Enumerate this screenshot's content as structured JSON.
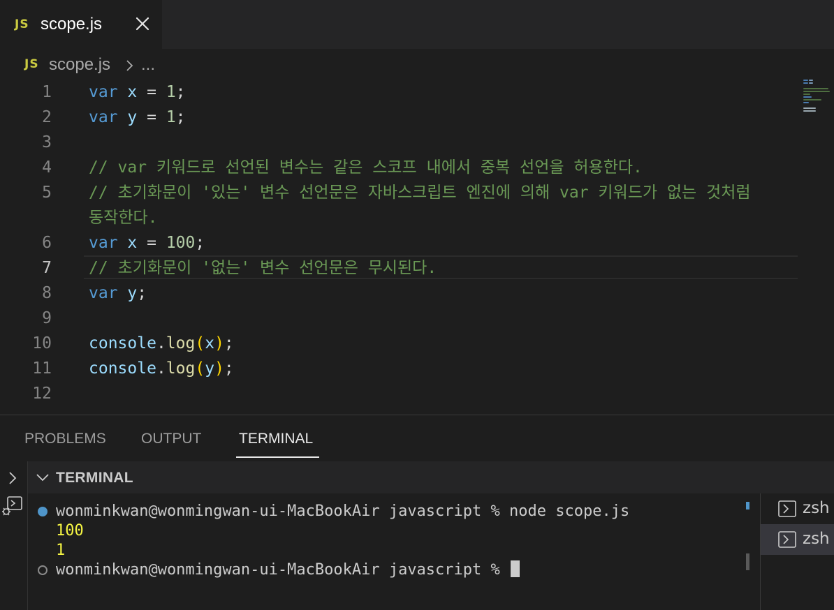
{
  "tab": {
    "badge": "JS",
    "title": "scope.js"
  },
  "breadcrumb": {
    "badge": "JS",
    "file": "scope.js",
    "more": "..."
  },
  "editor": {
    "line_numbers": [
      "1",
      "2",
      "3",
      "4",
      "5",
      "6",
      "7",
      "8",
      "9",
      "10",
      "11",
      "12"
    ],
    "current_line": "7",
    "code": {
      "kw_var": "var",
      "x": "x",
      "y": "y",
      "eq": " = ",
      "one": "1",
      "hundred": "100",
      "semi": ";",
      "comment_line4": "// var 키워드로 선언된 변수는 같은 스코프 내에서 중복 선언을 허용한다.",
      "comment_line5": "// 초기화문이 '있는' 변수 선언문은 자바스크립트 엔진에 의해 var 키워드가 없는 것처럼",
      "comment_line5_wrap": "동작한다.",
      "comment_line7": "// 초기화문이 '없는' 변수 선언문은 무시된다.",
      "console": "console",
      "dot": ".",
      "log": "log",
      "open_paren": "(",
      "close_paren": ")"
    }
  },
  "panel": {
    "tabs": [
      "PROBLEMS",
      "OUTPUT",
      "TERMINAL"
    ],
    "active_tab": "TERMINAL",
    "header_title": "TERMINAL"
  },
  "terminal": {
    "lines": [
      "wonminkwan@wonmingwan-ui-MacBookAir javascript % node scope.js",
      "100",
      "1",
      "wonminkwan@wonmingwan-ui-MacBookAir javascript % "
    ],
    "instances": [
      "zsh",
      "zsh"
    ],
    "selected_instance": 2
  },
  "colors": {
    "keyword": "#569cd6",
    "variable": "#9cdcfe",
    "number": "#b5cea8",
    "comment": "#6a9955",
    "function": "#dcdcaa",
    "js_badge": "#cbcb41",
    "output_yellow": "#f5f543",
    "success_dot": "#4f95c9"
  },
  "icons": [
    "close-icon",
    "chevron-right-icon",
    "chevron-down-icon",
    "debug-console-icon",
    "terminal-icon"
  ]
}
